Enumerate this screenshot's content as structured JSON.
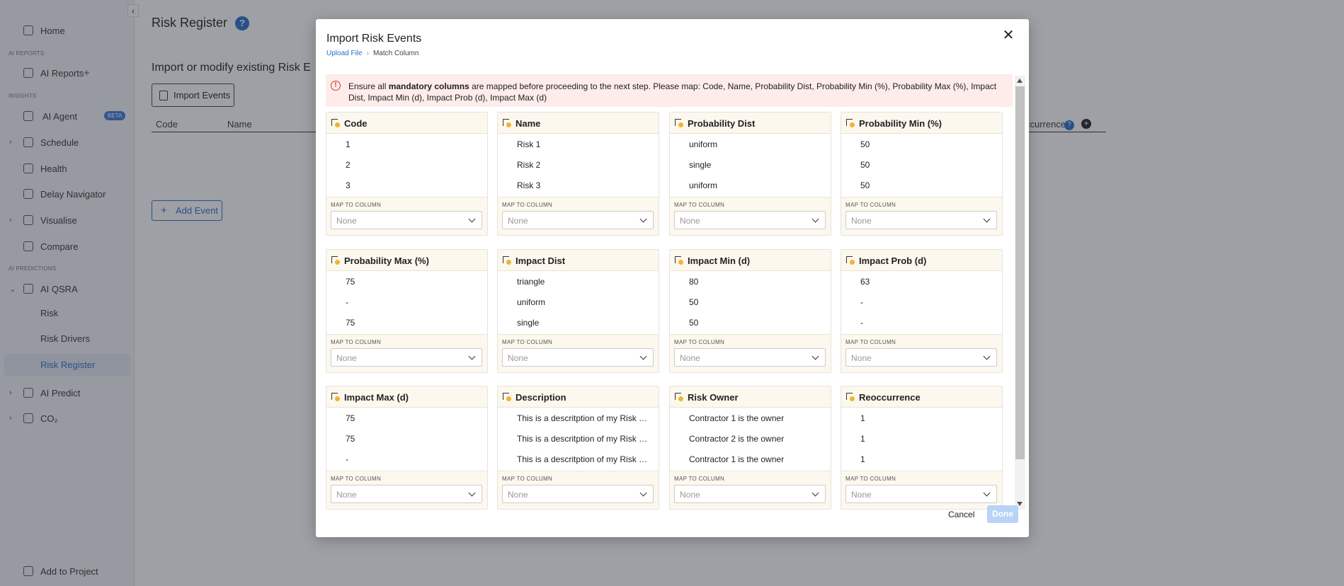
{
  "sidebar": {
    "collapse": "‹",
    "home": "Home",
    "sec_ai_reports": "AI REPORTS",
    "ai_reports": "AI Reports",
    "sec_insights": "INSIGHTS",
    "ai_agent": "AI Agent",
    "beta": "BETA",
    "schedule": "Schedule",
    "health": "Health",
    "delay_navigator": "Delay Navigator",
    "visualise": "Visualise",
    "compare": "Compare",
    "sec_ai_predictions": "AI PREDICTIONS",
    "ai_qsra": "AI QSRA",
    "risk": "Risk",
    "risk_drivers": "Risk Drivers",
    "risk_register": "Risk Register",
    "ai_predict": "AI Predict",
    "co2": "CO₂",
    "add_to_project": "Add to Project"
  },
  "main": {
    "title": "Risk Register",
    "help": "?",
    "subtitle": "Import or modify existing Risk E",
    "import_events": "Import Events",
    "col_code": "Code",
    "col_name": "Name",
    "col_reoccurrence": "ccurrence",
    "add_event": "Add Event"
  },
  "modal": {
    "title": "Import Risk Events",
    "close": "✕",
    "breadcrumb": {
      "step1": "Upload File",
      "sep": "›",
      "step2": "Match Column"
    },
    "alert": {
      "pre": "Ensure all ",
      "bold": "mandatory columns",
      "post": " are mapped before proceeding to the next step. Please map: Code, Name, Probability Dist, Probability Min (%), Probability Max (%), Impact Dist, Impact Min (d), Impact Prob (d), Impact Max (d)"
    },
    "map_label": "MAP TO COLUMN",
    "select_placeholder": "None",
    "cards": [
      {
        "title": "Code",
        "values": [
          "1",
          "2",
          "3"
        ]
      },
      {
        "title": "Name",
        "values": [
          "Risk 1",
          "Risk 2",
          "Risk 3"
        ]
      },
      {
        "title": "Probability Dist",
        "values": [
          "uniform",
          "single",
          "uniform"
        ]
      },
      {
        "title": "Probability Min (%)",
        "values": [
          "50",
          "50",
          "50"
        ]
      },
      {
        "title": "Probability Max (%)",
        "values": [
          "75",
          "-",
          "75"
        ]
      },
      {
        "title": "Impact Dist",
        "values": [
          "triangle",
          "uniform",
          "single"
        ]
      },
      {
        "title": "Impact Min (d)",
        "values": [
          "80",
          "50",
          "50"
        ]
      },
      {
        "title": "Impact Prob (d)",
        "values": [
          "63",
          "-",
          "-"
        ]
      },
      {
        "title": "Impact Max (d)",
        "values": [
          "75",
          "75",
          "-"
        ]
      },
      {
        "title": "Description",
        "values": [
          "This is a descritption of my Risk Event",
          "This is a descritption of my Risk Event",
          "This is a descritption of my Risk Event"
        ]
      },
      {
        "title": "Risk Owner",
        "values": [
          "Contractor 1 is the owner",
          "Contractor 2 is the owner",
          "Contractor 1 is the owner"
        ]
      },
      {
        "title": "Reoccurrence",
        "values": [
          "1",
          "1",
          "1"
        ]
      }
    ],
    "cancel": "Cancel",
    "done": "Done"
  }
}
